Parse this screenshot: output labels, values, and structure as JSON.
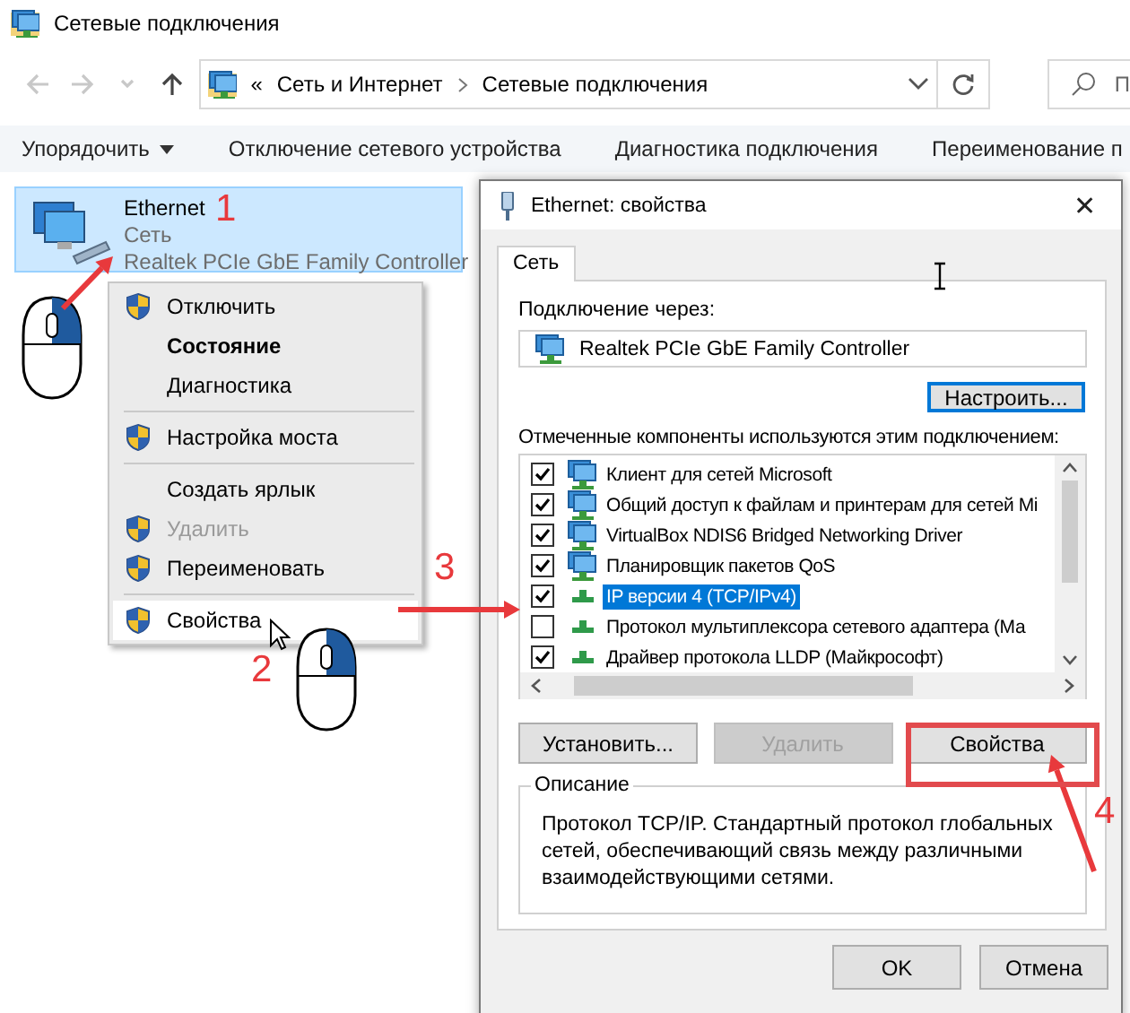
{
  "window": {
    "title": "Сетевые подключения"
  },
  "address_bar": {
    "overflow": "«",
    "path": [
      "Сеть и Интернет",
      "Сетевые подключения"
    ],
    "search_placeholder": "П"
  },
  "command_bar": [
    {
      "label": "Упорядочить",
      "dropdown": true
    },
    {
      "label": "Отключение сетевого устройства",
      "dropdown": false
    },
    {
      "label": "Диагностика подключения",
      "dropdown": false
    },
    {
      "label": "Переименование п",
      "dropdown": false
    }
  ],
  "connections": [
    {
      "name": "Ethernet",
      "network": "Сеть",
      "adapter": "Realtek PCIe GbE Family Controller",
      "selected": true
    }
  ],
  "context_menu": [
    {
      "kind": "item",
      "label": "Отключить",
      "shield": true,
      "default": false,
      "disabled": false,
      "selected": false
    },
    {
      "kind": "item",
      "label": "Состояние",
      "shield": false,
      "default": true,
      "disabled": false,
      "selected": false
    },
    {
      "kind": "item",
      "label": "Диагностика",
      "shield": false,
      "default": false,
      "disabled": false,
      "selected": false
    },
    {
      "kind": "separator"
    },
    {
      "kind": "item",
      "label": "Настройка моста",
      "shield": true,
      "default": false,
      "disabled": false,
      "selected": false
    },
    {
      "kind": "separator"
    },
    {
      "kind": "item",
      "label": "Создать ярлык",
      "shield": false,
      "default": false,
      "disabled": false,
      "selected": false
    },
    {
      "kind": "item",
      "label": "Удалить",
      "shield": true,
      "default": false,
      "disabled": true,
      "selected": false
    },
    {
      "kind": "item",
      "label": "Переименовать",
      "shield": true,
      "default": false,
      "disabled": false,
      "selected": false
    },
    {
      "kind": "separator"
    },
    {
      "kind": "item",
      "label": "Свойства",
      "shield": true,
      "default": false,
      "disabled": false,
      "selected": true
    }
  ],
  "dialog": {
    "title": "Ethernet: свойства",
    "close": "✕",
    "tabs": [
      {
        "label": "Сеть",
        "selected": true
      }
    ],
    "connect_using_label": "Подключение через:",
    "adapter": "Realtek PCIe GbE Family Controller",
    "configure_button": "Настроить...",
    "components_label": "Отмеченные компоненты используются этим подключением:",
    "components": [
      {
        "label": "Клиент для сетей Microsoft",
        "kind": "client",
        "checked": true,
        "selected": false
      },
      {
        "label": "Общий доступ к файлам и принтерам для сетей Mi",
        "kind": "client",
        "checked": true,
        "selected": false
      },
      {
        "label": "VirtualBox NDIS6 Bridged Networking Driver",
        "kind": "client",
        "checked": true,
        "selected": false
      },
      {
        "label": "Планировщик пакетов QoS",
        "kind": "client",
        "checked": true,
        "selected": false
      },
      {
        "label": "IP версии 4 (TCP/IPv4)",
        "kind": "protocol",
        "checked": true,
        "selected": true
      },
      {
        "label": "Протокол мультиплексора сетевого адаптера (Ма",
        "kind": "protocol",
        "checked": false,
        "selected": false
      },
      {
        "label": "Драйвер протокола LLDP (Майкрософт)",
        "kind": "protocol",
        "checked": true,
        "selected": false
      }
    ],
    "buttons": [
      {
        "label": "Установить...",
        "disabled": false
      },
      {
        "label": "Удалить",
        "disabled": true
      },
      {
        "label": "Свойства",
        "disabled": false
      }
    ],
    "description": {
      "title": "Описание",
      "text": "Протокол TCP/IP. Стандартный протокол глобальных сетей, обеспечивающий связь между различными взаимодействующими сетями."
    },
    "footer_buttons": [
      "OK",
      "Отмена"
    ]
  },
  "step_numbers": [
    "1",
    "2",
    "3",
    "4"
  ]
}
